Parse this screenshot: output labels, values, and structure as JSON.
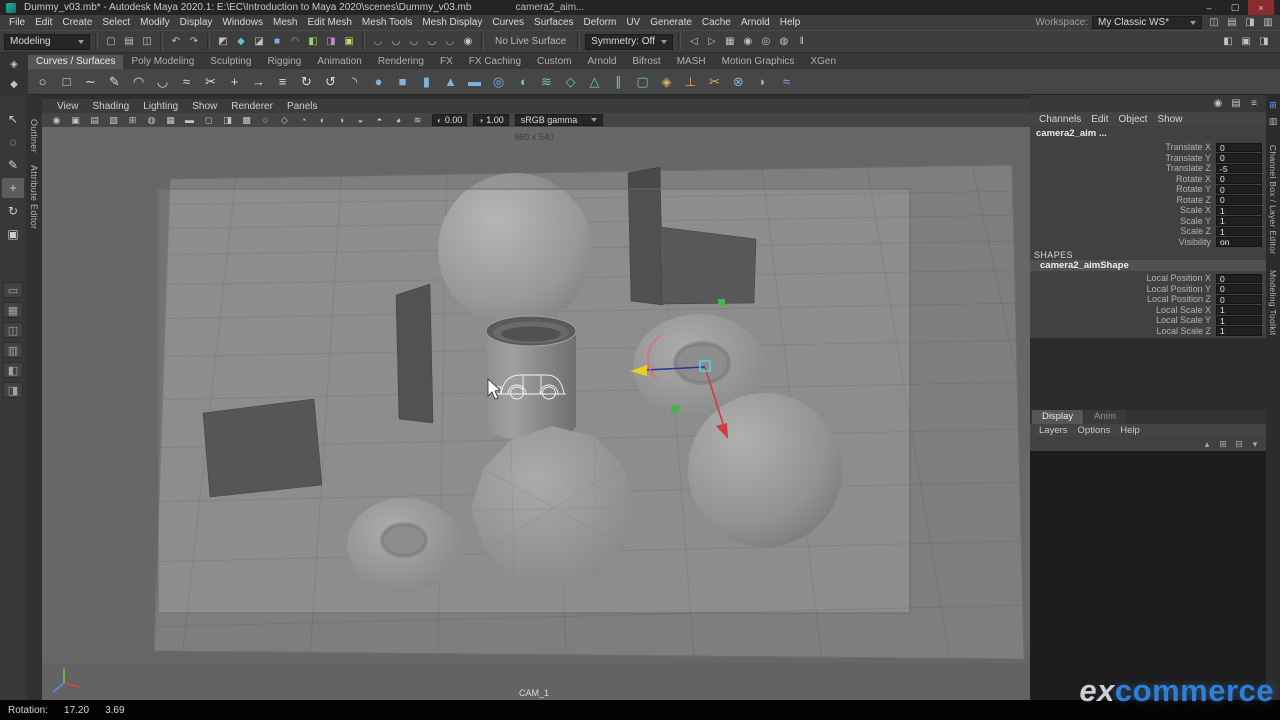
{
  "title_bar": {
    "document_title": "Dummy_v03.mb* - Autodesk Maya 2020.1: E:\\EC\\Introduction to Maya 2020\\scenes\\Dummy_v03.mb",
    "secondary_title": "camera2_aim...",
    "controls": {
      "minimize": "–",
      "maximize": "▢",
      "close": "×"
    }
  },
  "menu_bar": {
    "items": [
      "File",
      "Edit",
      "Create",
      "Select",
      "Modify",
      "Display",
      "Windows",
      "Mesh",
      "Edit Mesh",
      "Mesh Tools",
      "Mesh Display",
      "Curves",
      "Surfaces",
      "Deform",
      "UV",
      "Generate",
      "Cache",
      "Arnold",
      "Help"
    ],
    "workspace_label": "Workspace:",
    "workspace_value": "My Classic WS*",
    "right_icons": [
      {
        "name": "workspace-save-icon",
        "glyph": "◫"
      },
      {
        "name": "outliner-toggle-icon",
        "glyph": "▤"
      },
      {
        "name": "attribute-editor-toggle-icon",
        "glyph": "◨"
      },
      {
        "name": "channel-box-toggle-icon",
        "glyph": "▥"
      }
    ]
  },
  "status_line": {
    "mode": "Modeling",
    "file_icons": [
      {
        "name": "new-scene-icon",
        "glyph": "▢"
      },
      {
        "name": "open-scene-icon",
        "glyph": "▤"
      },
      {
        "name": "save-scene-icon",
        "glyph": "◫"
      }
    ],
    "history_icons": [
      {
        "name": "undo-icon",
        "glyph": "↶"
      },
      {
        "name": "redo-icon",
        "glyph": "↷"
      }
    ],
    "mask_icons": [
      {
        "name": "select-hierarchy-mask-icon",
        "glyph": "◩",
        "tint": "#c0c0c0"
      },
      {
        "name": "select-object-mask-icon",
        "glyph": "◆",
        "tint": "#5bc6c9"
      },
      {
        "name": "select-component-mask-icon",
        "glyph": "◪",
        "tint": "#c0c0c0"
      },
      {
        "name": "select-mesh-mask-icon",
        "glyph": "■",
        "tint": "#7ab0e6"
      },
      {
        "name": "select-curve-mask-icon",
        "glyph": "◠",
        "tint": "#d8a65e"
      },
      {
        "name": "select-surface-mask-icon",
        "glyph": "◧",
        "tint": "#9cd06d"
      },
      {
        "name": "select-deformation-mask-icon",
        "glyph": "◨",
        "tint": "#c783d0"
      },
      {
        "name": "select-rendering-mask-icon",
        "glyph": "▣",
        "tint": "#d2d26d"
      }
    ],
    "snap_icons": [
      {
        "name": "snap-to-grid-icon",
        "glyph": "◡",
        "tint": "#74b4e0"
      },
      {
        "name": "snap-to-curve-icon",
        "glyph": "◡",
        "tint": "#c6c6c6"
      },
      {
        "name": "snap-to-point-icon",
        "glyph": "◡",
        "tint": "#92d092"
      },
      {
        "name": "snap-to-projected-center-icon",
        "glyph": "◡",
        "tint": "#c6c6c6"
      },
      {
        "name": "snap-to-view-plane-icon",
        "glyph": "◡",
        "tint": "#dca86e"
      },
      {
        "name": "make-live-icon",
        "glyph": "◉",
        "tint": "#c6c6c6"
      }
    ],
    "live_surface_label": "No Live Surface",
    "symmetry_label": "Symmetry: Off",
    "render_icons": [
      {
        "name": "input-connections-icon",
        "glyph": "◁"
      },
      {
        "name": "output-connections-icon",
        "glyph": "▷"
      },
      {
        "name": "open-render-view-icon",
        "glyph": "▦"
      },
      {
        "name": "render-current-frame-icon",
        "glyph": "◉"
      },
      {
        "name": "ipr-render-icon",
        "glyph": "◎"
      },
      {
        "name": "render-settings-icon",
        "glyph": "◍"
      },
      {
        "name": "pause-icon",
        "glyph": "‖"
      }
    ],
    "sidebar_icons": [
      {
        "name": "show-attribute-editor-icon",
        "glyph": "◧"
      },
      {
        "name": "show-tool-settings-icon",
        "glyph": "▣"
      },
      {
        "name": "show-channel-box-icon",
        "glyph": "◨"
      }
    ]
  },
  "shelf": {
    "left_icons": [
      {
        "name": "shelf-menu-icon",
        "glyph": "◈"
      },
      {
        "name": "shelf-star-icon",
        "glyph": "◆"
      }
    ],
    "tabs": [
      "Curves / Surfaces",
      "Poly Modeling",
      "Sculpting",
      "Rigging",
      "Animation",
      "Rendering",
      "FX",
      "FX Caching",
      "Custom",
      "Arnold",
      "Bifrost",
      "MASH",
      "Motion Graphics",
      "XGen"
    ],
    "icons": [
      {
        "name": "circle-curve-icon",
        "glyph": "○",
        "tint": "#d8dcde"
      },
      {
        "name": "square-curve-icon",
        "glyph": "□",
        "tint": "#d8dcde"
      },
      {
        "name": "ep-curve-tool-icon",
        "glyph": "∼",
        "tint": "#d8dcde"
      },
      {
        "name": "pencil-curve-tool-icon",
        "glyph": "✎",
        "tint": "#d8dcde"
      },
      {
        "name": "three-point-arc-icon",
        "glyph": "◠",
        "tint": "#d8dcde"
      },
      {
        "name": "two-point-arc-icon",
        "glyph": "◡",
        "tint": "#d8dcde"
      },
      {
        "name": "attach-curves-icon",
        "glyph": "≈",
        "tint": "#d8dcde"
      },
      {
        "name": "detach-curves-icon",
        "glyph": "✂",
        "tint": "#d8dcde"
      },
      {
        "name": "insert-knot-icon",
        "glyph": "+",
        "tint": "#d8dcde"
      },
      {
        "name": "extend-curve-icon",
        "glyph": "→",
        "tint": "#d8dcde"
      },
      {
        "name": "offset-curve-icon",
        "glyph": "≡",
        "tint": "#d8dcde"
      },
      {
        "name": "rebuild-curve-icon",
        "glyph": "↻",
        "tint": "#d8dcde"
      },
      {
        "name": "reverse-curve-icon",
        "glyph": "↺",
        "tint": "#d8dcde"
      },
      {
        "name": "curve-fillet-icon",
        "glyph": "◝",
        "tint": "#d8dcde"
      },
      {
        "name": "nurbs-sphere-icon",
        "glyph": "●",
        "tint": "#7fb2dc"
      },
      {
        "name": "nurbs-cube-icon",
        "glyph": "■",
        "tint": "#7fb2dc"
      },
      {
        "name": "nurbs-cylinder-icon",
        "glyph": "▮",
        "tint": "#7fb2dc"
      },
      {
        "name": "nurbs-cone-icon",
        "glyph": "▲",
        "tint": "#7fb2dc"
      },
      {
        "name": "nurbs-plane-icon",
        "glyph": "▬",
        "tint": "#7fb2dc"
      },
      {
        "name": "nurbs-torus-icon",
        "glyph": "◎",
        "tint": "#7fb2dc"
      },
      {
        "name": "revolve-icon",
        "glyph": "◖",
        "tint": "#66c6bf"
      },
      {
        "name": "loft-icon",
        "glyph": "≋",
        "tint": "#66c6bf"
      },
      {
        "name": "planar-surface-icon",
        "glyph": "◇",
        "tint": "#66c6bf"
      },
      {
        "name": "extrude-surface-icon",
        "glyph": "△",
        "tint": "#66c6bf"
      },
      {
        "name": "birail-icon",
        "glyph": "∥",
        "tint": "#66c6bf"
      },
      {
        "name": "boundary-surface-icon",
        "glyph": "▢",
        "tint": "#66c6bf"
      },
      {
        "name": "bevel-plus-icon",
        "glyph": "◈",
        "tint": "#d8b05e"
      },
      {
        "name": "project-curve-icon",
        "glyph": "⊥",
        "tint": "#d8b05e"
      },
      {
        "name": "trim-tool-icon",
        "glyph": "✂",
        "tint": "#d8b05e"
      },
      {
        "name": "intersect-surfaces-icon",
        "glyph": "⊗",
        "tint": "#7fb2dc"
      },
      {
        "name": "surface-fillet-icon",
        "glyph": "◗",
        "tint": "#7fb2dc"
      },
      {
        "name": "stitch-surfaces-icon",
        "glyph": "≈",
        "tint": "#7fb2dc"
      }
    ]
  },
  "toolbox": {
    "tools": [
      {
        "name": "select-tool",
        "glyph": "↖"
      },
      {
        "name": "lasso-select-tool",
        "glyph": "◌"
      },
      {
        "name": "paint-select-tool",
        "glyph": "✎"
      },
      {
        "name": "move-tool",
        "glyph": "+"
      },
      {
        "name": "rotate-tool",
        "glyph": "↻"
      },
      {
        "name": "scale-tool",
        "glyph": "▣"
      }
    ],
    "layouts": [
      {
        "name": "single-pane-layout-button",
        "glyph": "▭"
      },
      {
        "name": "four-pane-layout-button",
        "glyph": "▦"
      },
      {
        "name": "two-pane-side-layout-button",
        "glyph": "◫"
      },
      {
        "name": "two-pane-stacked-layout-button",
        "glyph": "▥"
      },
      {
        "name": "outliner-persp-layout-button",
        "glyph": "◧"
      },
      {
        "name": "hypershade-persp-layout-button",
        "glyph": "◨"
      }
    ]
  },
  "side_tabs": {
    "left": [
      "Outliner",
      "Attribute Editor"
    ],
    "right": [
      "Channel Box / Layer Editor",
      "Modeling Toolkit"
    ],
    "right_icons": [
      {
        "name": "modeling-toolkit-icon",
        "glyph": "⊞",
        "tint": "#4da3ff"
      },
      {
        "name": "channel-box-icon",
        "glyph": "▥",
        "tint": "#b8b8b8"
      }
    ]
  },
  "viewport": {
    "menus": [
      "View",
      "Shading",
      "Lighting",
      "Show",
      "Renderer",
      "Panels"
    ],
    "toolbar_icons": [
      {
        "name": "camera-lock-icon",
        "glyph": "◉"
      },
      {
        "name": "camera-attributes-icon",
        "glyph": "▣"
      },
      {
        "name": "bookmark-icon",
        "glyph": "▤"
      },
      {
        "name": "image-plane-icon",
        "glyph": "▧"
      },
      {
        "name": "2d-pan-zoom-icon",
        "glyph": "⊞"
      },
      {
        "name": "oversampling-icon",
        "glyph": "◍"
      },
      {
        "name": "grid-icon",
        "glyph": "▦"
      },
      {
        "name": "film-gate-icon",
        "glyph": "▬"
      },
      {
        "name": "resolution-gate-icon",
        "glyph": "◻"
      },
      {
        "name": "gate-mask-icon",
        "glyph": "◨"
      },
      {
        "name": "field-chart-icon",
        "glyph": "▩"
      },
      {
        "name": "safe-action-icon",
        "glyph": "○"
      },
      {
        "name": "safe-title-icon",
        "glyph": "◇"
      },
      {
        "name": "wireframe-icon",
        "glyph": "◔"
      },
      {
        "name": "shaded-icon",
        "glyph": "◐"
      },
      {
        "name": "textured-icon",
        "glyph": "◑"
      },
      {
        "name": "lights-icon",
        "glyph": "◒"
      },
      {
        "name": "shadows-icon",
        "glyph": "◓"
      },
      {
        "name": "ao-icon",
        "glyph": "◕"
      },
      {
        "name": "motion-blur-icon",
        "glyph": "≋"
      }
    ],
    "exposure_icon": "◐",
    "exposure": "0.00",
    "gamma_icon": "◑",
    "gamma": "1.00",
    "color_space": "sRGB gamma",
    "gate_label": "960 x 540",
    "camera_label": "CAM_1"
  },
  "right_panel": {
    "top_icons": [
      {
        "name": "pin-panel-icon",
        "glyph": "◉"
      },
      {
        "name": "duplicate-panel-icon",
        "glyph": "▤"
      },
      {
        "name": "panel-menu-icon",
        "glyph": "≡"
      }
    ]
  },
  "channel_box": {
    "menu": [
      "Channels",
      "Edit",
      "Object",
      "Show"
    ],
    "object": "camera2_aim ...",
    "rows": [
      {
        "label": "Translate X",
        "value": "0"
      },
      {
        "label": "Translate Y",
        "value": "0"
      },
      {
        "label": "Translate Z",
        "value": "-5"
      },
      {
        "label": "Rotate X",
        "value": "0"
      },
      {
        "label": "Rotate Y",
        "value": "0"
      },
      {
        "label": "Rotate Z",
        "value": "0"
      },
      {
        "label": "Scale X",
        "value": "1"
      },
      {
        "label": "Scale Y",
        "value": "1"
      },
      {
        "label": "Scale Z",
        "value": "1"
      },
      {
        "label": "Visibility",
        "value": "on"
      }
    ],
    "shapes_label": "SHAPES",
    "shape_name": "camera2_aimShape",
    "shape_rows": [
      {
        "label": "Local Position X",
        "value": "0"
      },
      {
        "label": "Local Position Y",
        "value": "0"
      },
      {
        "label": "Local Position Z",
        "value": "0"
      },
      {
        "label": "Local Scale X",
        "value": "1"
      },
      {
        "label": "Local Scale Y",
        "value": "1"
      },
      {
        "label": "Local Scale Z",
        "value": "1"
      }
    ]
  },
  "layer_editor": {
    "tabs": [
      "Display",
      "Anim"
    ],
    "menu": [
      "Layers",
      "Options",
      "Help"
    ],
    "icons": [
      {
        "name": "move-layer-up-icon",
        "glyph": "▴"
      },
      {
        "name": "create-empty-layer-icon",
        "glyph": "⊞"
      },
      {
        "name": "create-layer-from-selected-icon",
        "glyph": "⊟"
      },
      {
        "name": "layer-options-icon",
        "glyph": "▾"
      }
    ]
  },
  "bottom_bar": {
    "label": "Rotation:",
    "value_1": "17.20",
    "value_2": "3.69"
  },
  "watermark": {
    "part1": "ex",
    "part2": "commerce",
    "brand_color": "#2e7fd8"
  }
}
